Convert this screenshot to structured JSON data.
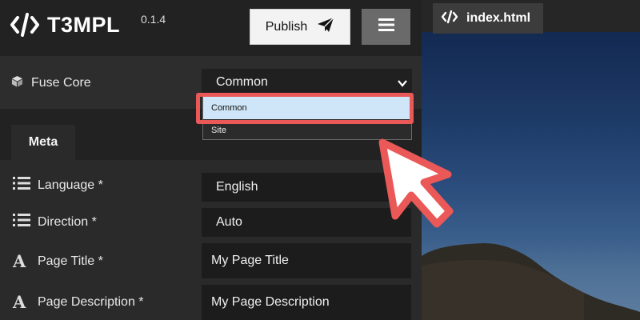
{
  "app": {
    "title": "T3MPL",
    "version": "0.1.4"
  },
  "header": {
    "publish_label": "Publish"
  },
  "core": {
    "label": "Fuse Core",
    "selected": "Common"
  },
  "dropdown": {
    "options": [
      "Common",
      "Site"
    ]
  },
  "tabs": [
    {
      "label": "Meta"
    }
  ],
  "fields": [
    {
      "label": "Language *",
      "value": "English",
      "icon": "list-icon"
    },
    {
      "label": "Direction *",
      "value": "Auto",
      "icon": "list-icon"
    },
    {
      "label": "Page Title *",
      "value": "My Page Title",
      "icon": "text-a-icon"
    },
    {
      "label": "Page Description *",
      "value": "My Page Description",
      "icon": "text-a-icon"
    }
  ],
  "preview": {
    "tab_label": "index.html"
  },
  "colors": {
    "highlight": "#ea5858",
    "selected_option": "#cfe6f8"
  }
}
